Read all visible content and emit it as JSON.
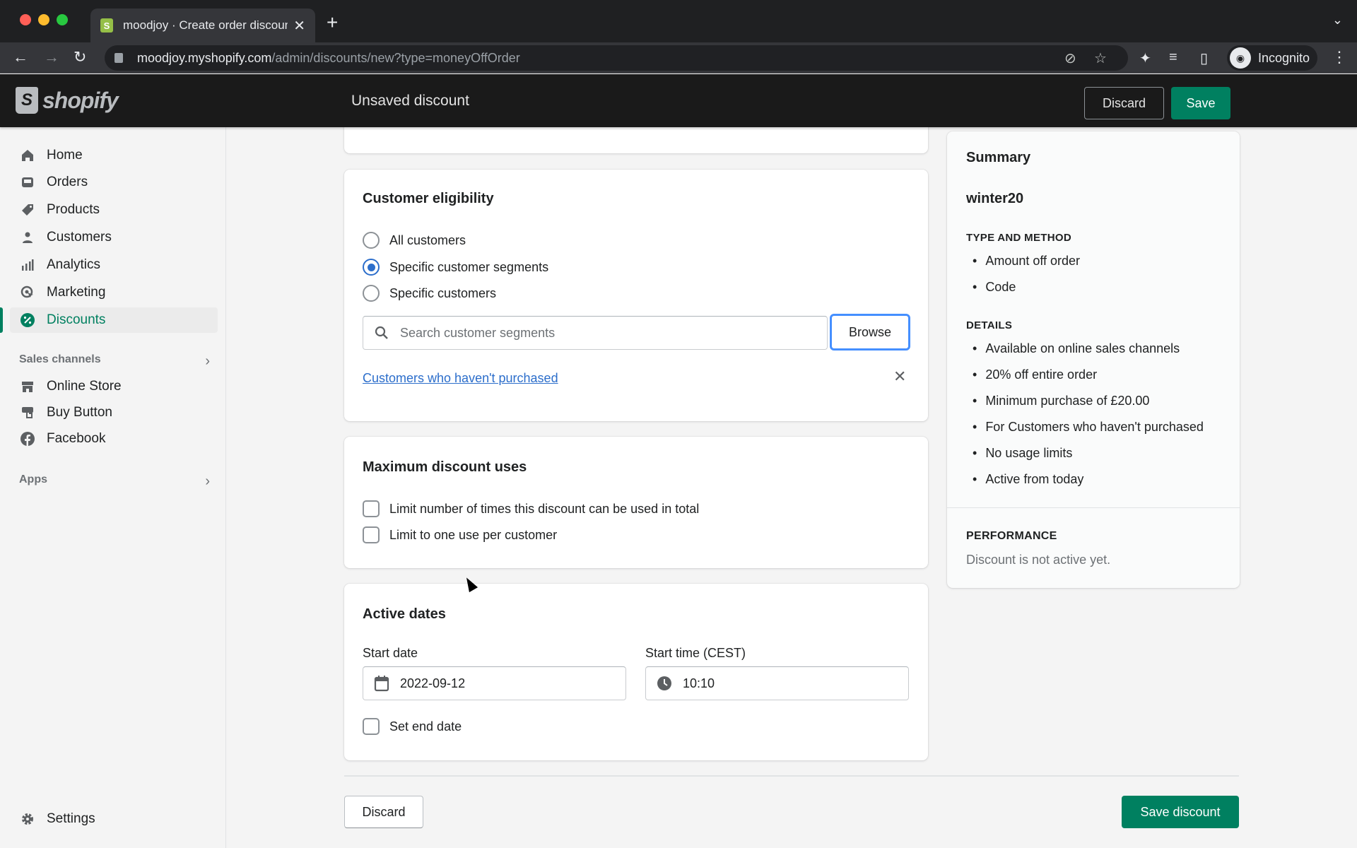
{
  "browser": {
    "tab_title": "moodjoy · Create order discount",
    "url_host": "moodjoy.myshopify.com",
    "url_path": "/admin/discounts/new?type=moneyOffOrder",
    "profile_label": "Incognito"
  },
  "topbar": {
    "brand": "shopify",
    "page_title": "Unsaved discount",
    "discard_label": "Discard",
    "save_label": "Save"
  },
  "sidebar": {
    "items": [
      {
        "label": "Home",
        "icon": "home-icon"
      },
      {
        "label": "Orders",
        "icon": "orders-icon"
      },
      {
        "label": "Products",
        "icon": "tag-icon"
      },
      {
        "label": "Customers",
        "icon": "person-icon"
      },
      {
        "label": "Analytics",
        "icon": "bar-chart-icon"
      },
      {
        "label": "Marketing",
        "icon": "target-icon"
      },
      {
        "label": "Discounts",
        "icon": "discount-icon",
        "active": true
      }
    ],
    "sales_channels_heading": "Sales channels",
    "channels": [
      {
        "label": "Online Store",
        "icon": "store-icon"
      },
      {
        "label": "Buy Button",
        "icon": "buy-button-icon"
      },
      {
        "label": "Facebook",
        "icon": "facebook-icon"
      }
    ],
    "apps_heading": "Apps",
    "settings_label": "Settings"
  },
  "eligibility": {
    "title": "Customer eligibility",
    "options": [
      {
        "label": "All customers",
        "selected": false
      },
      {
        "label": "Specific customer segments",
        "selected": true
      },
      {
        "label": "Specific customers",
        "selected": false
      }
    ],
    "search_placeholder": "Search customer segments",
    "browse_label": "Browse",
    "selected_segment": "Customers who haven't purchased"
  },
  "max_uses": {
    "title": "Maximum discount uses",
    "options": [
      {
        "label": "Limit number of times this discount can be used in total",
        "checked": false
      },
      {
        "label": "Limit to one use per customer",
        "checked": false
      }
    ]
  },
  "active_dates": {
    "title": "Active dates",
    "start_date_label": "Start date",
    "start_date_value": "2022-09-12",
    "start_time_label": "Start time (CEST)",
    "start_time_value": "10:10",
    "end_date_label": "Set end date",
    "end_date_checked": false
  },
  "summary": {
    "title": "Summary",
    "code": "winter20",
    "type_heading": "TYPE AND METHOD",
    "type_items": [
      "Amount off order",
      "Code"
    ],
    "details_heading": "DETAILS",
    "details_items": [
      "Available on online sales channels",
      "20% off entire order",
      "Minimum purchase of £20.00",
      "For Customers who haven't purchased",
      "No usage limits",
      "Active from today"
    ],
    "performance_heading": "PERFORMANCE",
    "performance_text": "Discount is not active yet."
  },
  "footer": {
    "discard_label": "Discard",
    "save_label": "Save discount"
  },
  "colors": {
    "primary": "#008060",
    "link": "#2c6ecb",
    "focus": "#458fff"
  }
}
